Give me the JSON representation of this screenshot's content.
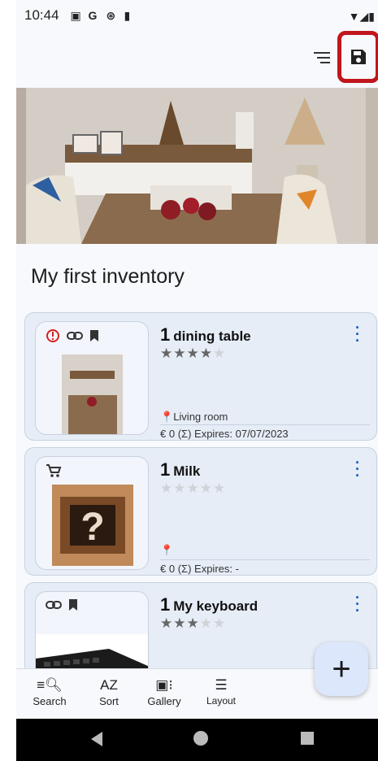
{
  "status": {
    "time": "10:44",
    "icons": [
      "image-icon",
      "g-icon",
      "sync-icon",
      "sd-card-icon"
    ]
  },
  "title": "My first inventory",
  "cards": [
    {
      "quantity": "1",
      "name": "dining table",
      "rating": 4,
      "location": "Living room",
      "price": "€ 0",
      "sum_symbol": "(Σ)",
      "expires": "Expires: 07/07/2023"
    },
    {
      "quantity": "1",
      "name": "Milk",
      "rating": 0,
      "location": "",
      "price": "€ 0",
      "sum_symbol": "(Σ)",
      "expires": "Expires: -"
    },
    {
      "quantity": "1",
      "name": "My keyboard",
      "rating": 3
    }
  ],
  "fab_label": "+",
  "bottom_nav": {
    "search": "Search",
    "sort": "Sort",
    "gallery": "Gallery",
    "layout": "Layout",
    "sort_icon": "AZ"
  },
  "colors": {
    "accent": "#1a56b8",
    "highlight": "#c0161c",
    "alert": "#d71f1f"
  }
}
